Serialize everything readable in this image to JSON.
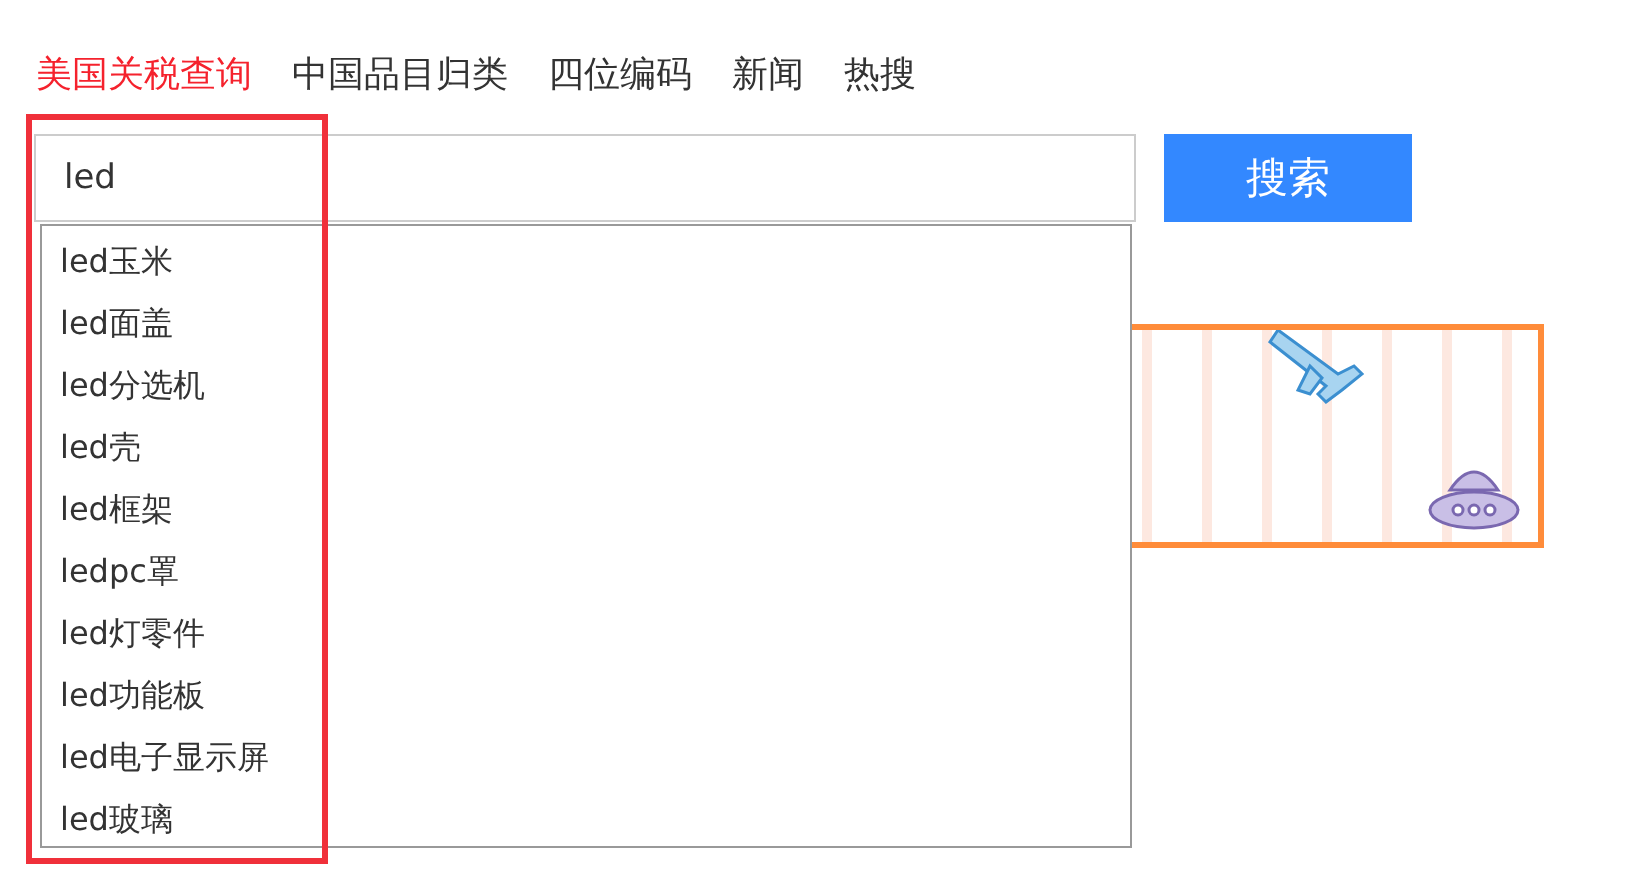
{
  "nav_tabs": [
    {
      "label": "美国关税查询",
      "selected": true
    },
    {
      "label": "中国品目归类",
      "selected": false
    },
    {
      "label": "四位编码",
      "selected": false
    },
    {
      "label": "新闻",
      "selected": false
    },
    {
      "label": "热搜",
      "selected": false
    }
  ],
  "search": {
    "value": "led",
    "button": "搜索"
  },
  "suggestions": [
    "led玉米",
    "led面盖",
    "led分选机",
    "led壳",
    "led框架",
    "ledpc罩",
    "led灯零件",
    "led功能板",
    "led电子显示屏",
    "led玻璃"
  ]
}
